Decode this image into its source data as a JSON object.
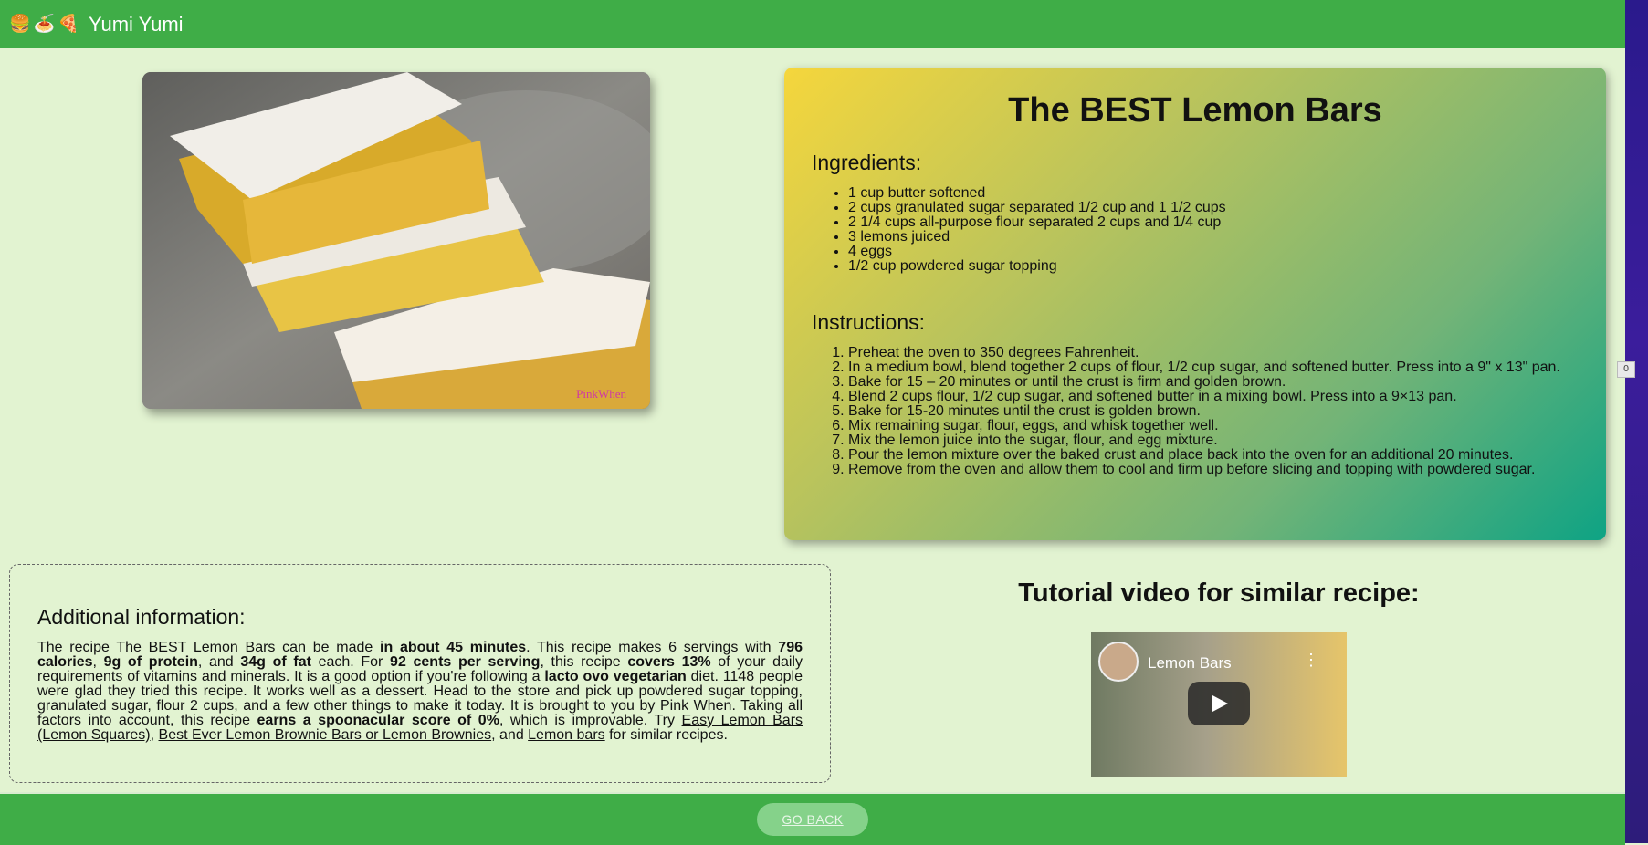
{
  "header": {
    "brand_icons": [
      "🍔",
      "🍝",
      "🍕"
    ],
    "app_title": "Yumi Yumi"
  },
  "side_badge": "0",
  "photo": {
    "alt": "Lemon bars dusted with powdered sugar",
    "watermark": "PinkWhen"
  },
  "recipe": {
    "title": "The BEST Lemon Bars",
    "ingredients_heading": "Ingredients:",
    "ingredients": [
      "1 cup butter softened",
      "2 cups granulated sugar separated 1/2 cup and 1 1/2 cups",
      "2 1/4 cups all-purpose flour separated 2 cups and 1/4 cup",
      "3 lemons juiced",
      "4 eggs",
      "1/2 cup powdered sugar topping"
    ],
    "instructions_heading": "Instructions:",
    "instructions": [
      "Preheat the oven to 350 degrees Fahrenheit.",
      "In a medium bowl, blend together 2 cups of flour, 1/2 cup sugar, and softened butter. Press into a 9\" x 13\" pan.",
      "Bake for 15 – 20 minutes or until the crust is firm and golden brown.",
      "Blend 2 cups flour, 1/2 cup sugar, and softened butter in a mixing bowl. Press into a 9×13 pan.",
      "Bake for 15-20 minutes until the crust is golden brown.",
      "Mix remaining sugar, flour, eggs, and whisk together well.",
      "Mix the lemon juice into the sugar, flour, and egg mixture.",
      "Pour the lemon mixture over the baked crust and place back into the oven for an additional 20 minutes.",
      "Remove from the oven and allow them to cool and firm up before slicing and topping with powdered sugar."
    ]
  },
  "info": {
    "heading": "Additional information:",
    "t1": "The recipe The BEST Lemon Bars can be made ",
    "b1": "in about 45 minutes",
    "t2": ". This recipe makes 6 servings with ",
    "b2": "796 calories",
    "t3": ", ",
    "b3": "9g of protein",
    "t4": ", and ",
    "b4": "34g of fat",
    "t5": " each. For ",
    "b5": "92 cents per serving",
    "t6": ", this recipe ",
    "b6": "covers 13%",
    "t7": " of your daily requirements of vitamins and minerals. It is a good option if you're following a ",
    "b7": "lacto ovo vegetarian",
    "t8": " diet. 1148 people were glad they tried this recipe. It works well as a dessert. Head to the store and pick up powdered sugar topping, granulated sugar, flour 2 cups, and a few other things to make it today. It is brought to you by Pink When. Taking all factors into account, this recipe ",
    "b8": "earns a spoonacular score of 0%",
    "t9": ", which is improvable. Try ",
    "link1": "Easy Lemon Bars (Lemon Squares)",
    "t10": ", ",
    "link2": "Best Ever Lemon Brownie Bars or Lemon Brownies",
    "t11": ", and ",
    "link3": "Lemon bars",
    "t12": " for similar recipes."
  },
  "video": {
    "heading": "Tutorial video for similar recipe:",
    "title": "Lemon Bars",
    "menu_glyph": "⋮"
  },
  "footer": {
    "go_back_label": "GO BACK"
  }
}
